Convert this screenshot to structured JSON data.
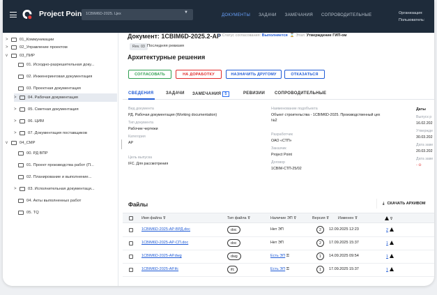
{
  "topbar": {
    "app_title": "Project Point",
    "project_value": "1CBIM6D-2025. Цех",
    "nav": [
      "ДОКУМЕНТЫ",
      "ЗАДАЧИ",
      "ЗАМЕЧАНИЯ",
      "СОПРОВОДИТЕЛЬНЫЕ"
    ],
    "active_nav": "ДОКУМЕНТЫ",
    "org_label": "Организация:",
    "user_label": "Пользователь:"
  },
  "sidebar": {
    "items": [
      {
        "label": "01_Коммуникации",
        "caret": ">"
      },
      {
        "label": "02_Управление проектом",
        "caret": ">"
      },
      {
        "label": "03_ПИР",
        "caret": "v"
      },
      {
        "label": "01. Исходно-разрешительная доку...",
        "caret": ""
      },
      {
        "label": "02. Инженеринговая документация",
        "caret": ""
      },
      {
        "label": "03. Проектная документация",
        "caret": ""
      },
      {
        "label": "04. Рабочая документация",
        "caret": ">"
      },
      {
        "label": "05. Сметная документация",
        "caret": ">"
      },
      {
        "label": "06. ЦИМ",
        "caret": ">"
      },
      {
        "label": "07. Документация поставщиков",
        "caret": ">"
      },
      {
        "label": "04_СМР",
        "caret": "v"
      },
      {
        "label": "00. РД ВПР",
        "caret": ""
      },
      {
        "label": "01. Проект производства работ (П...",
        "caret": ""
      },
      {
        "label": "02. Планирование и выполнение...",
        "caret": ""
      },
      {
        "label": "03. Исполнительная документаци...",
        "caret": ">"
      },
      {
        "label": "04. Акты выполненных работ",
        "caret": ""
      },
      {
        "label": "05. ТQ",
        "caret": ""
      }
    ]
  },
  "document": {
    "title": "Документ: 1CBIM6D-2025.2-АР",
    "status_label": "Статус согласования:",
    "status_value": "Выполняется",
    "stage_label": "Этап:",
    "stage_value": "Утверждение ГИП-ом",
    "rev_badge": "Rev. 03",
    "rev_text": "Последняя ревизия",
    "subtitle": "Архитектурные решения"
  },
  "actions": {
    "approve": "СОГЛАСОВАТЬ",
    "rework": "НА ДОРАБОТКУ",
    "reassign": "НАЗНАЧИТЬ ДРУГОМУ",
    "refuse": "ОТКАЗАТЬСЯ"
  },
  "tabs": {
    "info": "СВЕДЕНИЯ",
    "tasks": "ЗАДАЧИ",
    "remarks": "ЗАМЕЧАНИЯ",
    "remarks_count": "5",
    "revisions": "РЕВИЗИИ",
    "accompanying": "СОПРОВОДИТЕЛЬНЫЕ"
  },
  "info": {
    "doc_type_label": "Вид документа",
    "doc_type_value": "РД. Рабочая документация (Working documentation)",
    "type_label": "Тип документа",
    "type_value": "Рабочие чертежи",
    "category_label": "Категория",
    "category_value": "АР",
    "purpose_label": "Цель выпуска",
    "purpose_value": "IFC. Для рассмотрения",
    "object_label": "Наименование подобъекта",
    "object_value_1": "Объект строительства - 1CBIM6D-2025. Производственный цех",
    "object_value_2": "№2",
    "developer_label": "Разработчик",
    "developer_value": "ОАО «СТП»",
    "customer_label": "Заказчик",
    "customer_value": "Project Point",
    "contract_label": "Договор",
    "contract_value": "1CBIM-СТП-25/02",
    "dates_label": "Даты",
    "issue_label": "Выпуск р",
    "issue_value": "16.02.202",
    "approve_label": "Утвержде",
    "approve_value": "30.03.202",
    "date3_label": "Дата заве",
    "date3_value": "20.03.202",
    "date4_label": "Дата заве",
    "date4_value": "-"
  },
  "files": {
    "title": "Файлы",
    "download_label": "СКАЧАТЬ АРХИВОМ",
    "columns": {
      "name": "Имя файла",
      "type": "Тип файла",
      "ep": "Наличие ЭП",
      "version": "Версия",
      "changed": "Изменен",
      "remarks": ""
    },
    "rows": [
      {
        "name": "1CBIM6D-2025-АР-ВРД.doc",
        "type": "doc",
        "ep": "Нет ЭП",
        "version": "2",
        "changed": "12.09.2025 12:23",
        "count": "2"
      },
      {
        "name": "1CBIM6D-2025-АР-СП.doc",
        "type": "doc",
        "ep": "Нет ЭП",
        "version": "2",
        "changed": "17.09.2025 15:37",
        "count": "1"
      },
      {
        "name": "1CBIM6D-2025-АР.dwg",
        "type": "dwg",
        "ep": "Есть ЭП",
        "version": "1",
        "changed": "14.09.2025 09:54",
        "count": "1"
      },
      {
        "name": "1CBIM6D-2025-АР.ifc",
        "type": "ifc",
        "ep": "Есть ЭП",
        "version": "1",
        "changed": "17.09.2025 15:37",
        "count": "1"
      }
    ]
  },
  "colors": {
    "topbar": "#1e2b3a",
    "accent": "#1f5bd6",
    "approve": "#2e9e4f",
    "danger": "#e02b2b"
  },
  "icons": [
    "menu-icon",
    "logo-icon",
    "folder-icon",
    "filter-icon",
    "download-icon",
    "key-icon",
    "warning-icon"
  ]
}
